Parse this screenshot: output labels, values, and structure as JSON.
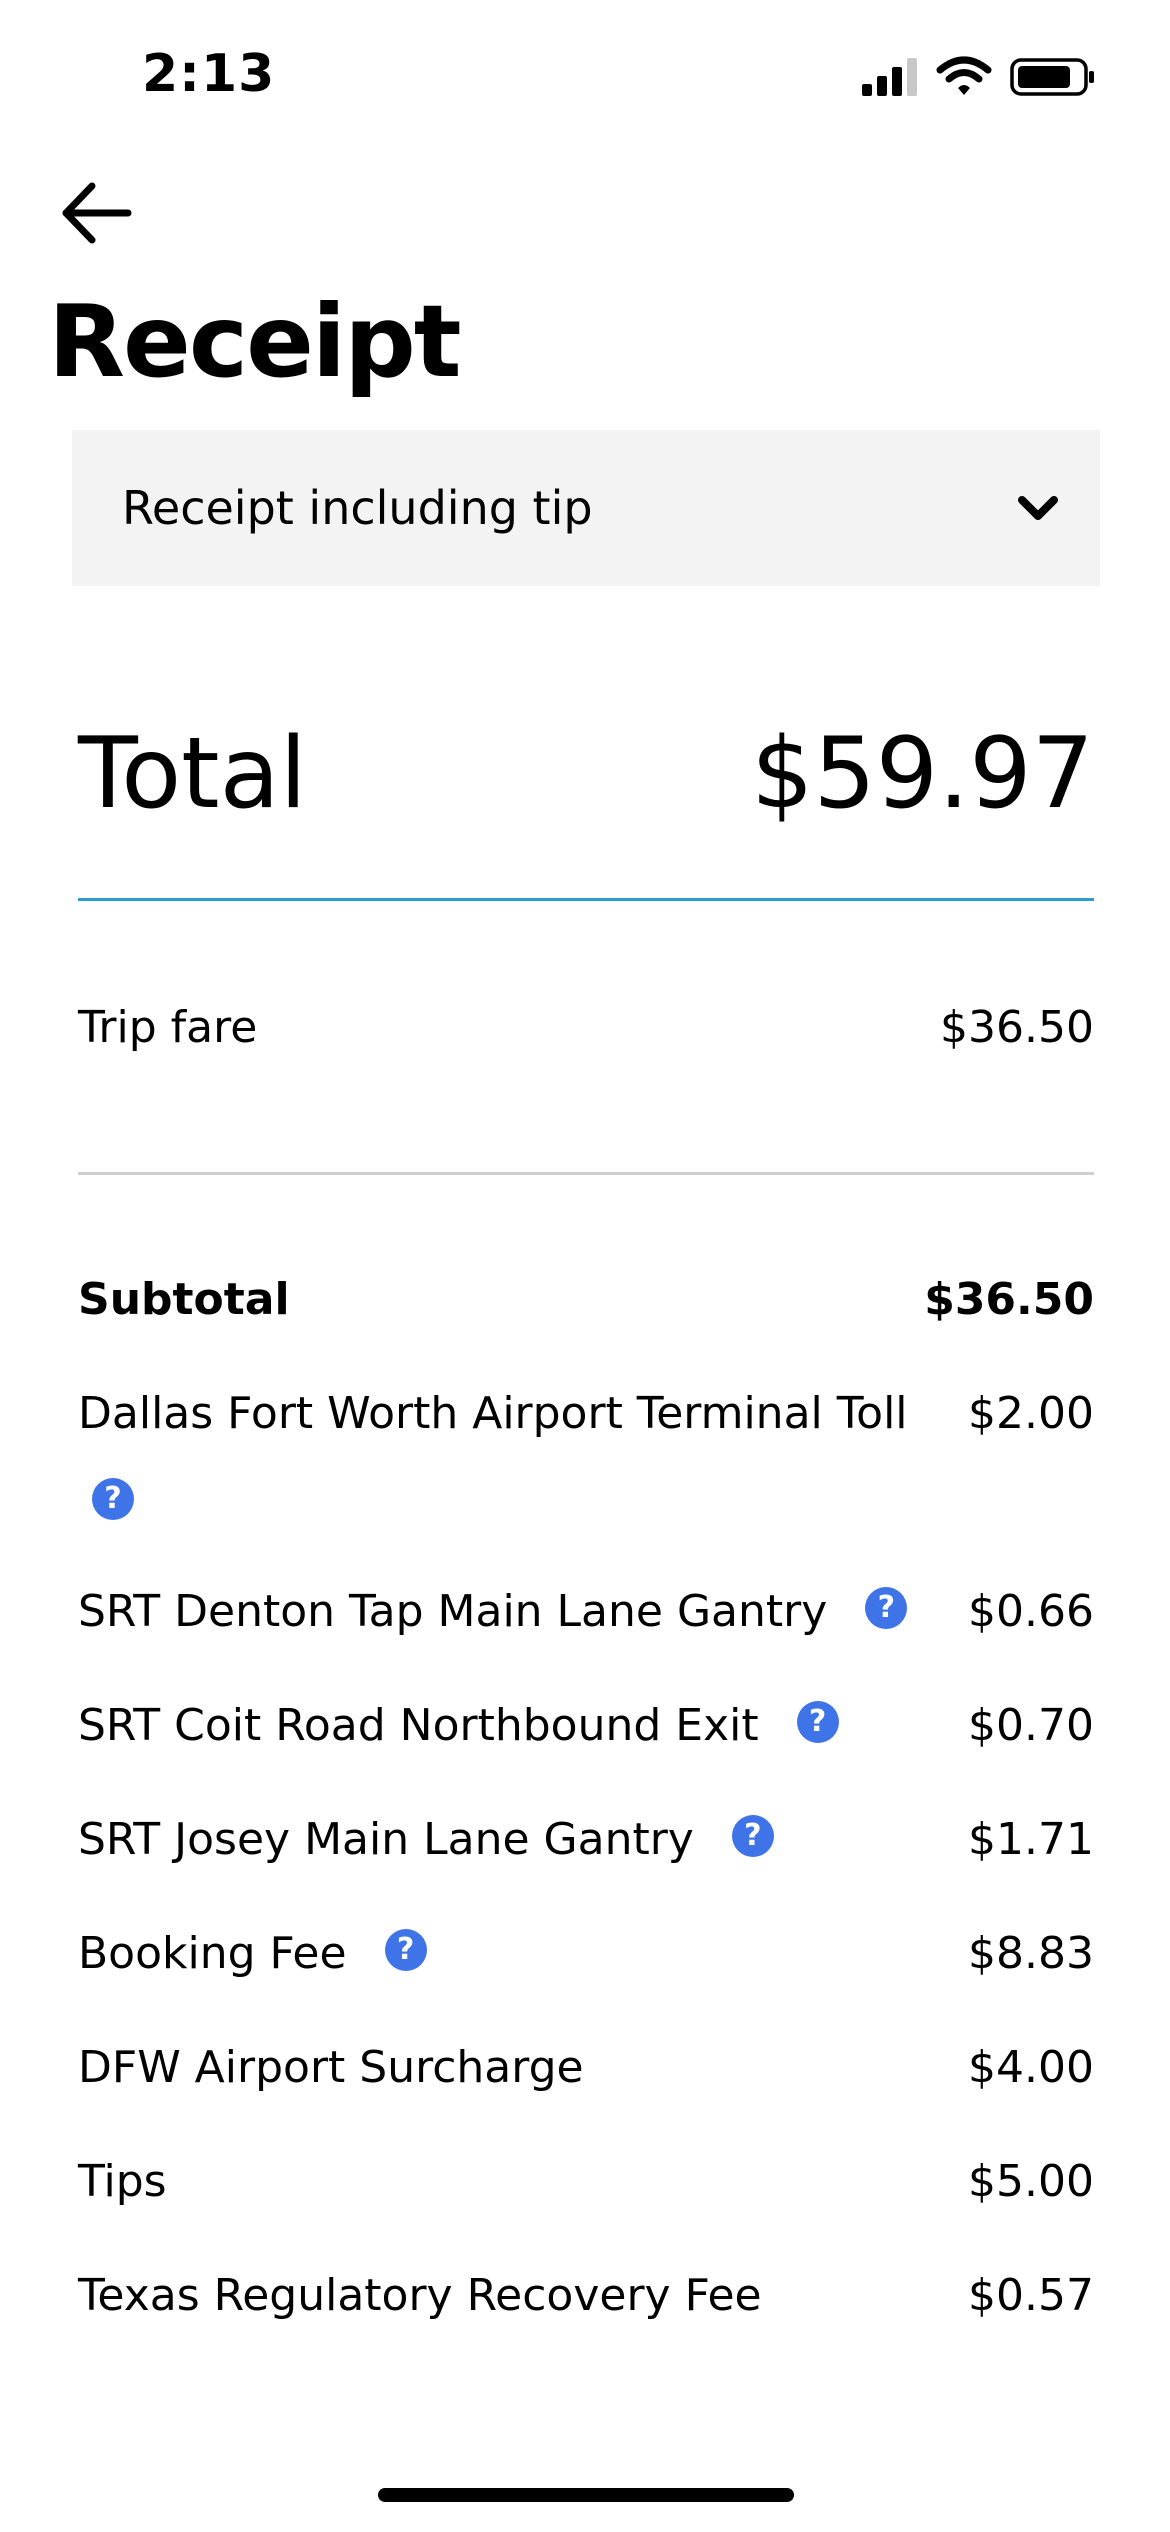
{
  "status_bar": {
    "time": "2:13",
    "icons": [
      "signal-icon",
      "wifi-icon",
      "battery-icon"
    ]
  },
  "header": {
    "back_icon": "arrow-left-icon",
    "title": "Receipt"
  },
  "receipt_select": {
    "selected": "Receipt including tip",
    "icon": "chevron-down-icon"
  },
  "total": {
    "label": "Total",
    "value": "$59.97",
    "divider_color": "#2f9ccf"
  },
  "fare": {
    "label": "Trip fare",
    "value": "$36.50"
  },
  "breakdown": {
    "subtotal": {
      "label": "Subtotal",
      "value": "$36.50"
    },
    "items": [
      {
        "label_line1": "Dallas Fort Worth Airport Terminal Toll",
        "value": "$2.00",
        "help": true
      },
      {
        "label": "SRT Denton Tap Main Lane Gantry",
        "value": "$0.66",
        "help": true
      },
      {
        "label": "SRT Coit Road Northbound Exit",
        "value": "$0.70",
        "help": true
      },
      {
        "label": "SRT Josey Main Lane Gantry",
        "value": "$1.71",
        "help": true
      },
      {
        "label": "Booking Fee",
        "value": "$8.83",
        "help": true
      },
      {
        "label": "DFW Airport Surcharge",
        "value": "$4.00",
        "help": false
      },
      {
        "label": "Tips",
        "value": "$5.00",
        "help": false
      },
      {
        "label": "Texas Regulatory Recovery Fee",
        "value": "$0.57",
        "help": false
      }
    ],
    "help_glyph": "?",
    "help_color": "#3e74e8"
  }
}
